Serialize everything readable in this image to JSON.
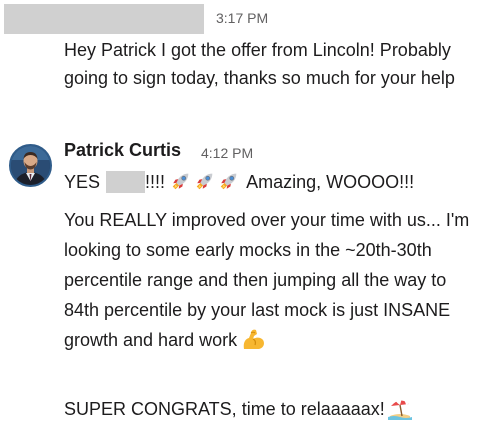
{
  "messages": [
    {
      "sender": "",
      "time": "3:17 PM",
      "text": "Hey Patrick I got the offer from Lincoln! Probably going to sign today, thanks so much for your help"
    },
    {
      "sender": "Patrick Curtis",
      "time": "4:12 PM",
      "line1_prefix": "YES",
      "line1_exclaim": "!!!!",
      "line1_suffix": "Amazing, WOOOO!!!",
      "para2": "You REALLY improved over your time with us... I'm looking to some early mocks in the ~20th-30th percentile range and then jumping all the way to 84th percentile by your last mock is just INSANE growth and hard work",
      "para3": "SUPER CONGRATS, time to relaaaaax!"
    }
  ],
  "icons": {
    "rocket": "rocket-icon",
    "muscle": "flexed-biceps-icon",
    "beach": "beach-umbrella-icon"
  },
  "colors": {
    "text": "#1d1c1d",
    "timestamp": "#616061",
    "redaction": "#d0d0d0"
  }
}
